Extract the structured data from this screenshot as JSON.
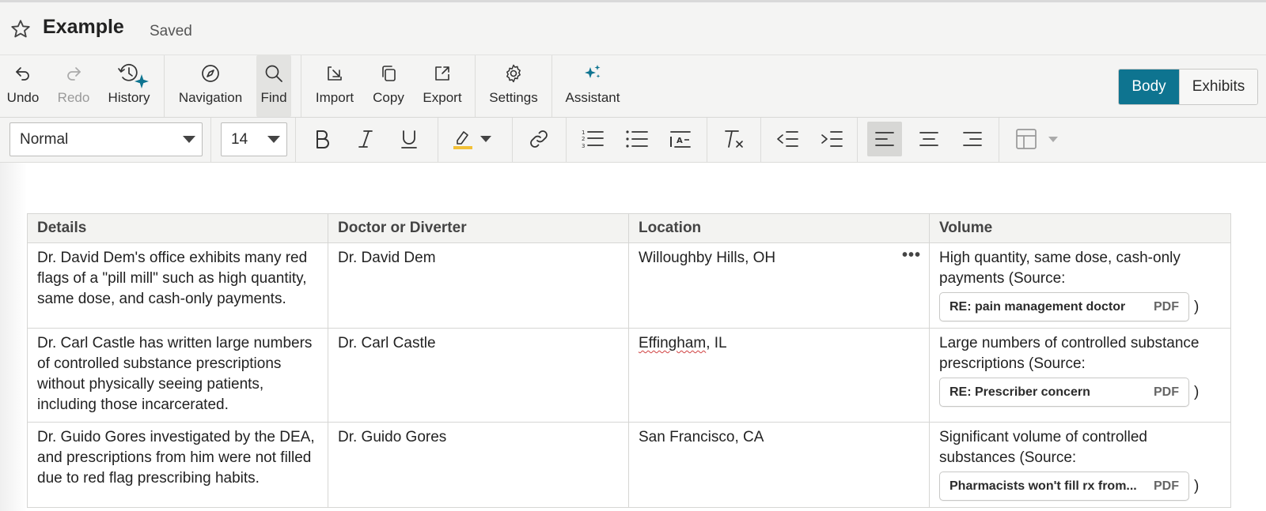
{
  "doc": {
    "title": "Example",
    "status": "Saved"
  },
  "toolbar": {
    "undo": "Undo",
    "redo": "Redo",
    "history": "History",
    "navigation": "Navigation",
    "find": "Find",
    "import": "Import",
    "copy": "Copy",
    "export": "Export",
    "settings": "Settings",
    "assistant": "Assistant",
    "view_tabs": [
      "Body",
      "Exhibits"
    ],
    "active_view": "Body"
  },
  "format": {
    "style_value": "Normal",
    "size_value": "14",
    "highlight_color": "#f2c037",
    "alignment": "left"
  },
  "accent_color": "#0e7490",
  "table": {
    "headers": [
      "Details",
      "Doctor or Diverter",
      "Location",
      "Volume"
    ],
    "rows": [
      {
        "details": "Dr. David Dem's office exhibits many red flags of a \"pill mill\" such as high quantity, same dose, and cash-only payments.",
        "doctor": "Dr. David Dem",
        "location": "Willoughby Hills, OH",
        "volume": "High quantity, same dose, cash-only payments (Source:",
        "source_name": "RE: pain management doctor",
        "source_type": "PDF"
      },
      {
        "details": "Dr. Carl Castle has written large numbers of controlled substance prescriptions without physically seeing patients, including those incarcerated.",
        "doctor": "Dr. Carl Castle",
        "location_city": "Effingham",
        "location_state": ", IL",
        "volume": "Large numbers of controlled substance prescriptions (Source:",
        "source_name": "RE: Prescriber concern",
        "source_type": "PDF"
      },
      {
        "details": "Dr. Guido Gores investigated by the DEA, and prescriptions from him were not filled due to red flag prescribing habits.",
        "doctor": "Dr. Guido Gores",
        "location": "San Francisco, CA",
        "volume": "Significant volume of controlled substances (Source:",
        "source_name": "Pharmacists won't fill rx from...",
        "source_type": "PDF"
      }
    ],
    "close_paren": ")",
    "more_glyph": "•••"
  }
}
